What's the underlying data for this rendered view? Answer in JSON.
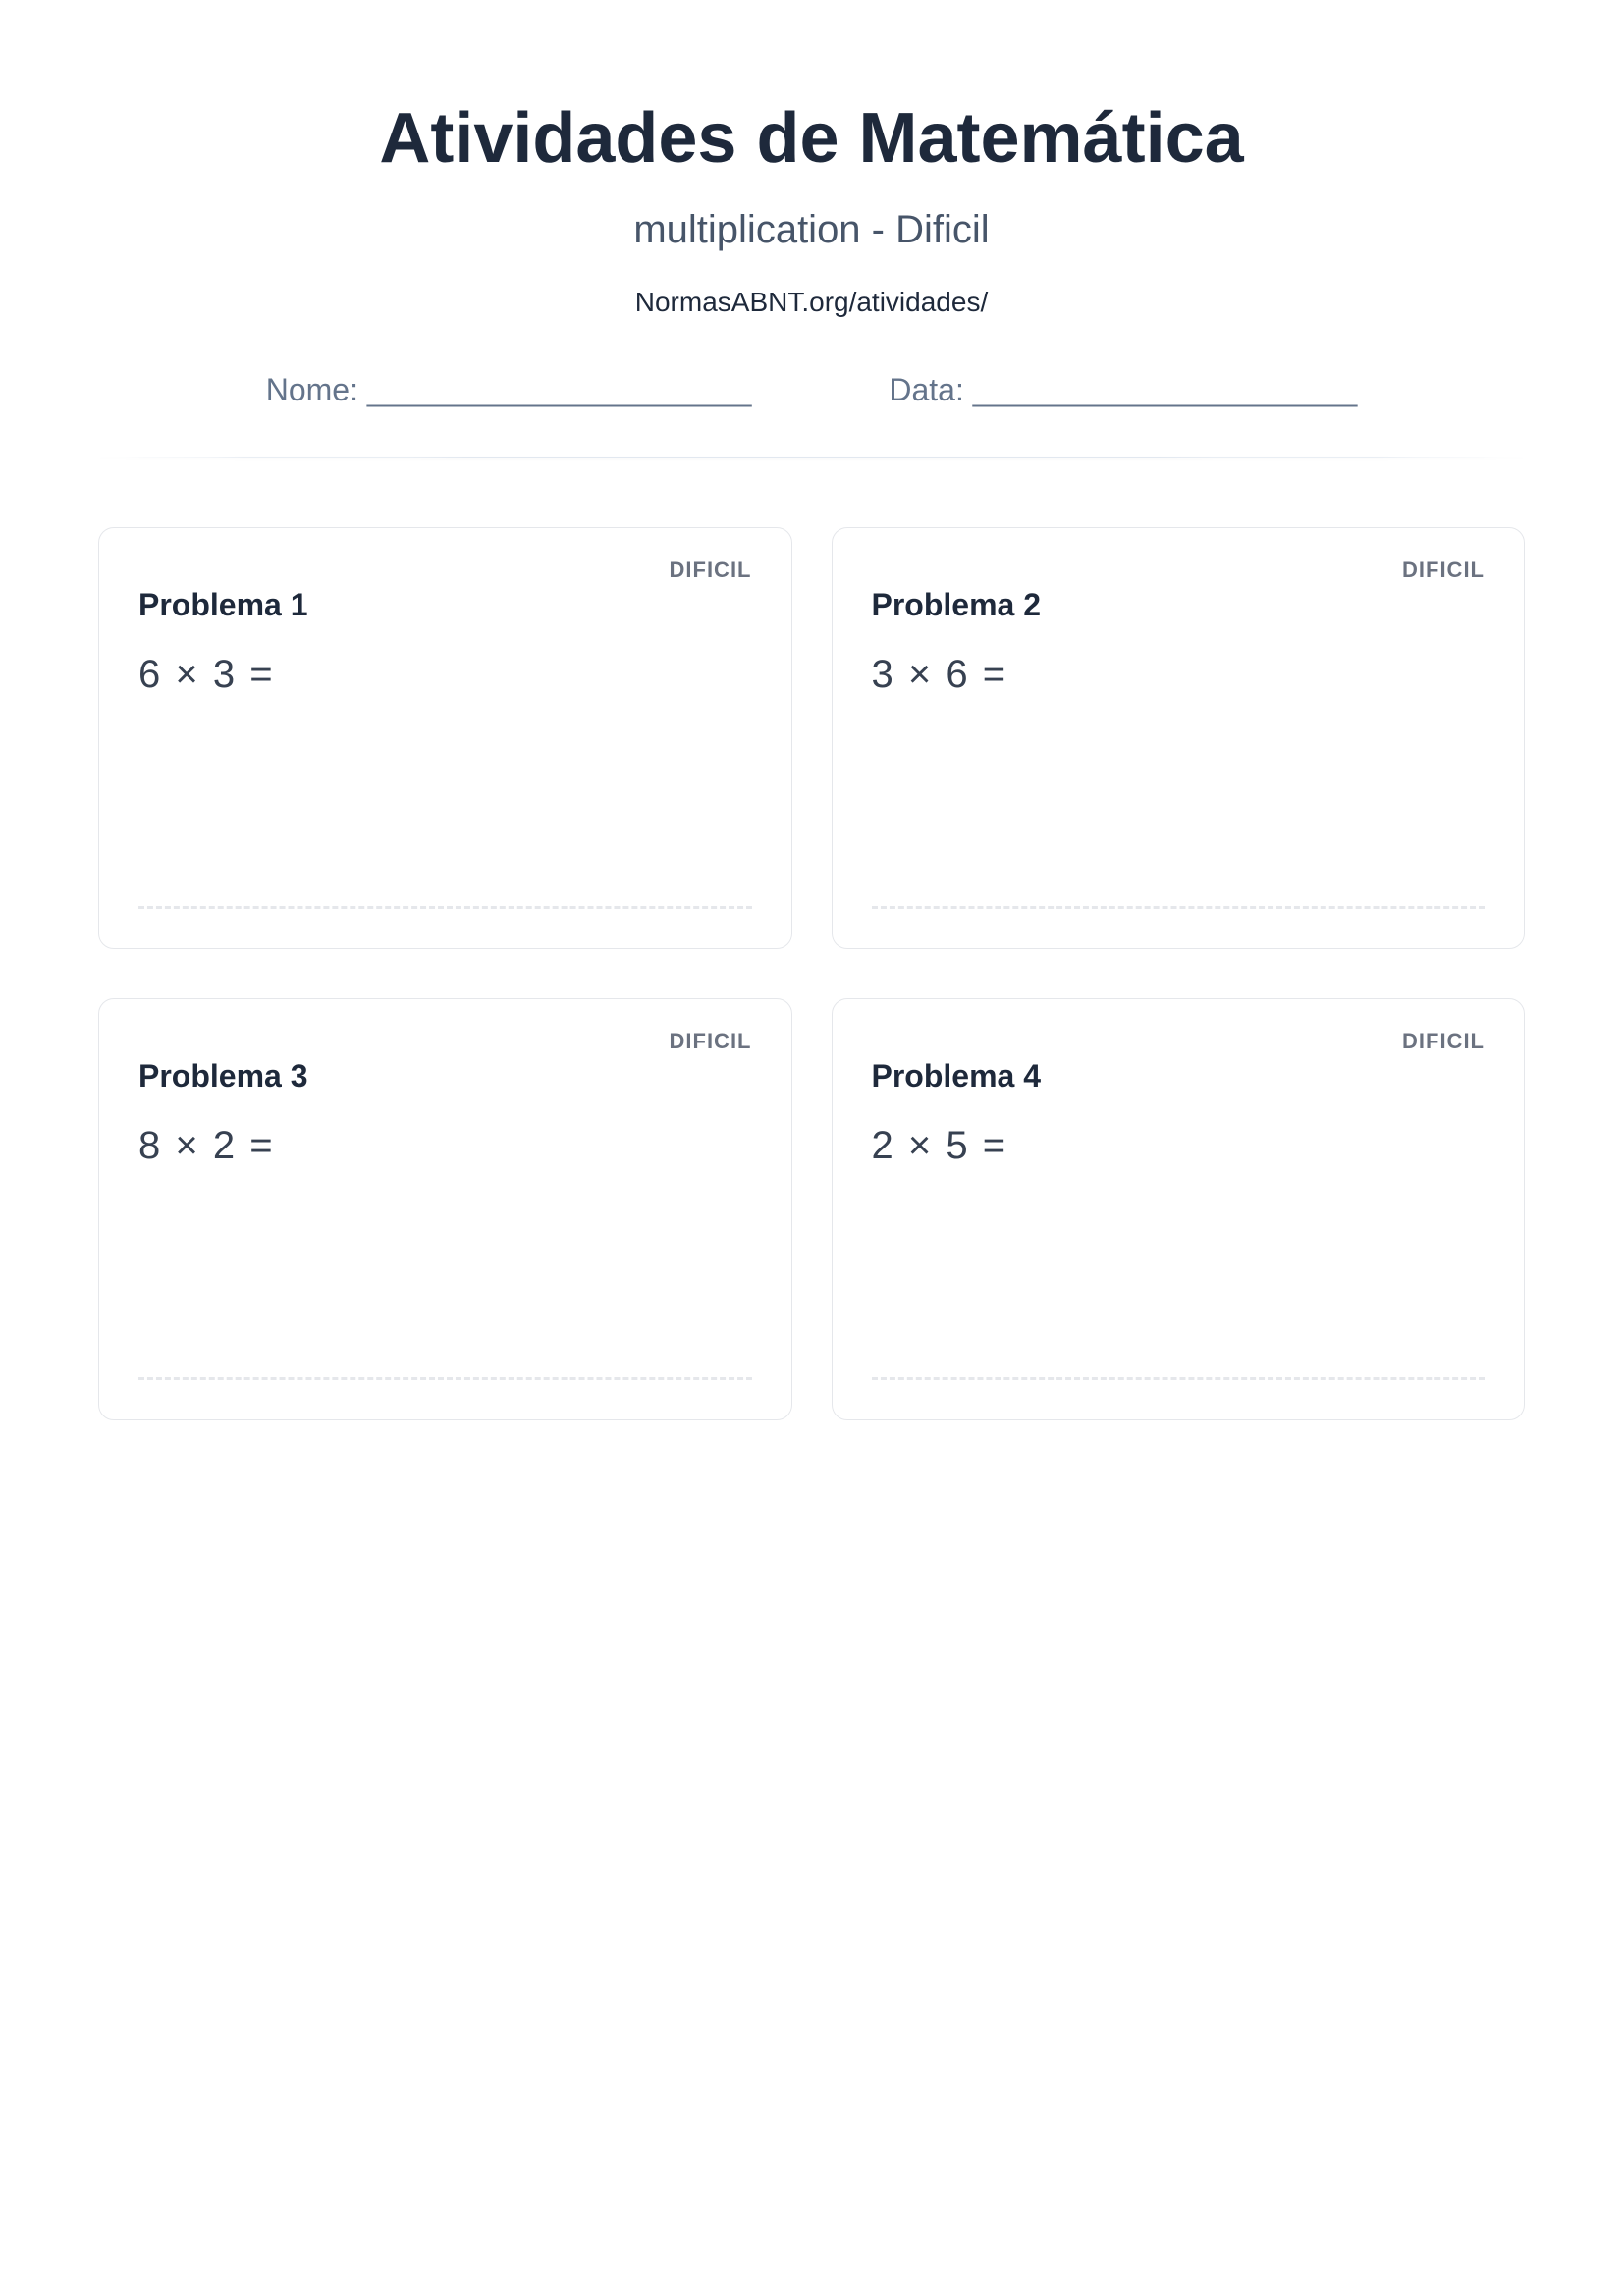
{
  "header": {
    "title": "Atividades de Matemática",
    "subtitle": "multiplication - Dificil",
    "url": "NormasABNT.org/atividades/",
    "name_label": "Nome: ______________________",
    "date_label": "Data: ______________________"
  },
  "difficulty_label": "DIFICIL",
  "problems": [
    {
      "label": "Problema 1",
      "equation": "6 × 3 ="
    },
    {
      "label": "Problema 2",
      "equation": "3 × 6 ="
    },
    {
      "label": "Problema 3",
      "equation": "8 × 2 ="
    },
    {
      "label": "Problema 4",
      "equation": "2 × 5 ="
    }
  ]
}
